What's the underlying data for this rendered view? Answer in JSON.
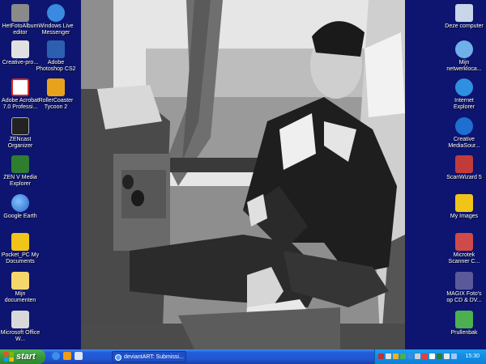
{
  "desktop": {
    "left_icons": [
      {
        "label": "HetFotoAlbum editor",
        "icon": "photo-album-icon",
        "color": "#8a8a8a"
      },
      {
        "label": "Windows Live Messenger",
        "icon": "messenger-icon",
        "color": "#3a8be0"
      },
      {
        "label": "Creative-pro...",
        "icon": "creative-icon",
        "color": "#e0e0e0"
      },
      {
        "label": "Adobe Photoshop CS2",
        "icon": "photoshop-icon",
        "color": "#2b5fb0"
      },
      {
        "label": "Adobe Acrobat 7.0 Professi...",
        "icon": "acrobat-icon",
        "color": "#d12b2b"
      },
      {
        "label": "RollerCoaster Tycoon 2",
        "icon": "rollercoaster-icon",
        "color": "#e8a21c"
      },
      {
        "label": "ZENcast Organizer",
        "icon": "zencast-icon",
        "color": "#222222"
      },
      {
        "label": "ZEN V Media Explorer",
        "icon": "zen-media-icon",
        "color": "#2f7d2f"
      },
      {
        "label": "Google Earth",
        "icon": "google-earth-icon",
        "color": "#2c63c7"
      },
      {
        "label": "Pocket_PC My Documents",
        "icon": "folder-sync-icon",
        "color": "#f0c419"
      },
      {
        "label": "Mijn documenten",
        "icon": "my-documents-icon",
        "color": "#f5d66a"
      },
      {
        "label": "Microsoft Office W...",
        "icon": "office-icon",
        "color": "#d9d9d9"
      }
    ],
    "right_icons": [
      {
        "label": "Deze computer",
        "icon": "computer-icon",
        "color": "#c9d6ea"
      },
      {
        "label": "Mijn netwerkloca...",
        "icon": "network-icon",
        "color": "#6fb0e8"
      },
      {
        "label": "Internet Explorer",
        "icon": "ie-icon",
        "color": "#2f8fe0"
      },
      {
        "label": "Creative MediaSour...",
        "icon": "mediasource-icon",
        "color": "#1e6fd0"
      },
      {
        "label": "ScanWizard 5",
        "icon": "scanwizard-icon",
        "color": "#c23b3b"
      },
      {
        "label": "My Images",
        "icon": "folder-icon",
        "color": "#f0c419"
      },
      {
        "label": "Microtek Scanner C...",
        "icon": "scanner-icon",
        "color": "#d04a4a"
      },
      {
        "label": "MAGIX Foto's op CD & DV...",
        "icon": "magix-icon",
        "color": "#5a5a9a"
      },
      {
        "label": "Prullenbak",
        "icon": "recycle-bin-icon",
        "color": "#4caf50"
      }
    ]
  },
  "taskbar": {
    "start_label": "start",
    "task_label": "deviantART: Submissi...",
    "clock": "15:30",
    "colors": {
      "start": "#3c9a3c",
      "bar": "#245edb",
      "tray": "#1290e8"
    }
  }
}
